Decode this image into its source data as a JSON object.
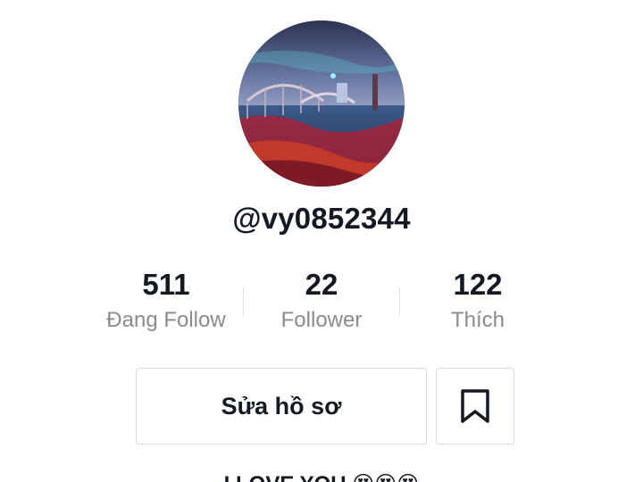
{
  "profile": {
    "username": "@vy0852344",
    "avatar_alt": "profile-photo",
    "bio": "I LOVE YOU 😍😍😍"
  },
  "stats": [
    {
      "value": "511",
      "label": "Đang Follow"
    },
    {
      "value": "22",
      "label": "Follower"
    },
    {
      "value": "122",
      "label": "Thích"
    }
  ],
  "actions": {
    "edit_label": "Sửa hồ sơ",
    "bookmark_icon": "bookmark-icon"
  },
  "colors": {
    "text": "#161823",
    "muted": "#8a8b91",
    "border": "#dcdcdf"
  }
}
